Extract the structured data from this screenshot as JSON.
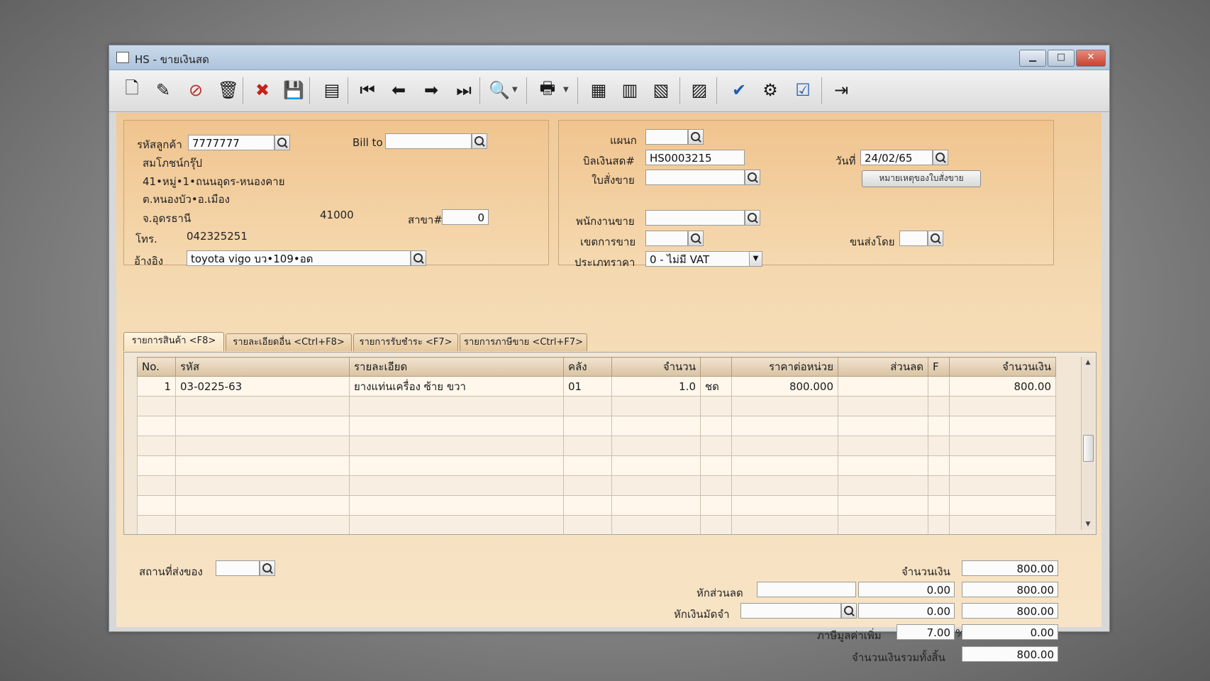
{
  "window": {
    "title": "HS - ขายเงินสด"
  },
  "toolbar": {
    "buttons": [
      {
        "name": "new-doc-icon",
        "glyph": "🗋"
      },
      {
        "name": "edit-icon",
        "glyph": "✎"
      },
      {
        "name": "void-icon",
        "glyph": "⊘"
      },
      {
        "name": "trash-icon",
        "glyph": "🗑"
      },
      {
        "name": "cancel-icon",
        "glyph": "✖"
      },
      {
        "name": "save-icon",
        "glyph": "💾"
      },
      {
        "name": "stack-icon",
        "glyph": "▤"
      },
      {
        "name": "first-record-icon",
        "glyph": "⏮"
      },
      {
        "name": "prev-record-icon",
        "glyph": "⬅"
      },
      {
        "name": "next-record-icon",
        "glyph": "➡"
      },
      {
        "name": "last-record-icon",
        "glyph": "⏭"
      },
      {
        "name": "search-doc-icon",
        "glyph": "🔍"
      },
      {
        "name": "print-icon",
        "glyph": "🖶"
      },
      {
        "name": "report-a-icon",
        "glyph": "▦"
      },
      {
        "name": "report-b-icon",
        "glyph": "▥"
      },
      {
        "name": "report-c-icon",
        "glyph": "▧"
      },
      {
        "name": "calendar-icon",
        "glyph": "▨"
      },
      {
        "name": "approve-icon",
        "glyph": "✔"
      },
      {
        "name": "tools-icon",
        "glyph": "⚙"
      },
      {
        "name": "ok-icon",
        "glyph": "☑"
      },
      {
        "name": "exit-icon",
        "glyph": "⇥"
      }
    ]
  },
  "customer": {
    "code_label": "รหัสลูกค้า",
    "code": "7777777",
    "name": "สมโภชน์กรุ๊ป",
    "addr1": "41•หมู่•1•ถนนอุดร-หนองคาย",
    "addr2": "ต.หนองบัว•อ.เมือง",
    "province": "จ.อุดรธานี",
    "zip": "41000",
    "branch_label": "สาขา#",
    "branch": "0",
    "tel_label": "โทร.",
    "tel": "042325251",
    "ref_label": "อ้างอิง",
    "ref": "toyota vigo บว•109•อด",
    "billto_label": "Bill to",
    "billto": ""
  },
  "doc": {
    "dept_label": "แผนก",
    "dept": "",
    "bill_label": "บิลเงินสด#",
    "bill": "HS0003215",
    "order_label": "ใบสั่งขาย",
    "order": "",
    "date_label": "วันที่",
    "date": "24/02/65",
    "note_button": "หมายเหตุของใบสั่งขาย",
    "salesman_label": "พนักงานขาย",
    "salesman": "",
    "area_label": "เขตการขาย",
    "area": "",
    "shipby_label": "ขนส่งโดย",
    "shipby": "",
    "pricetype_label": "ประเภทราคา",
    "pricetype": "0 - ไม่มี VAT"
  },
  "tabs": [
    {
      "label": "รายการสินค้า <F8>"
    },
    {
      "label": "รายละเอียดอื่น <Ctrl+F8>"
    },
    {
      "label": "รายการรับชำระ <F7>"
    },
    {
      "label": "รายการภาษีขาย <Ctrl+F7>"
    }
  ],
  "grid": {
    "headers": [
      "No.",
      "รหัส",
      "รายละเอียด",
      "คลัง",
      "จำนวน",
      "",
      "ราคาต่อหน่วย",
      "ส่วนลด",
      "F",
      "จำนวนเงิน"
    ],
    "rows": [
      [
        "1",
        "03-0225-63",
        "ยางแท่นเครื่อง ซ้าย ขวา",
        "01",
        "1.0",
        "ชด",
        "800.000",
        "",
        "",
        "800.00"
      ]
    ]
  },
  "footer": {
    "ship_label": "สถานที่ส่งของ",
    "ship": "",
    "amount_label": "จำนวนเงิน",
    "amount": "800.00",
    "discount_label": "หักส่วนลด",
    "discount_code": "",
    "discount": "0.00",
    "after_discount": "800.00",
    "deposit_label": "หักเงินมัดจำ",
    "deposit_code": "",
    "deposit": "0.00",
    "after_deposit": "800.00",
    "vat_label": "ภาษีมูลค่าเพิ่ม",
    "vat_rate": "7.00",
    "vat_pct": "%",
    "vat_amount": "0.00",
    "total_label": "จำนวนเงินรวมทั้งสิ้น",
    "total": "800.00"
  }
}
